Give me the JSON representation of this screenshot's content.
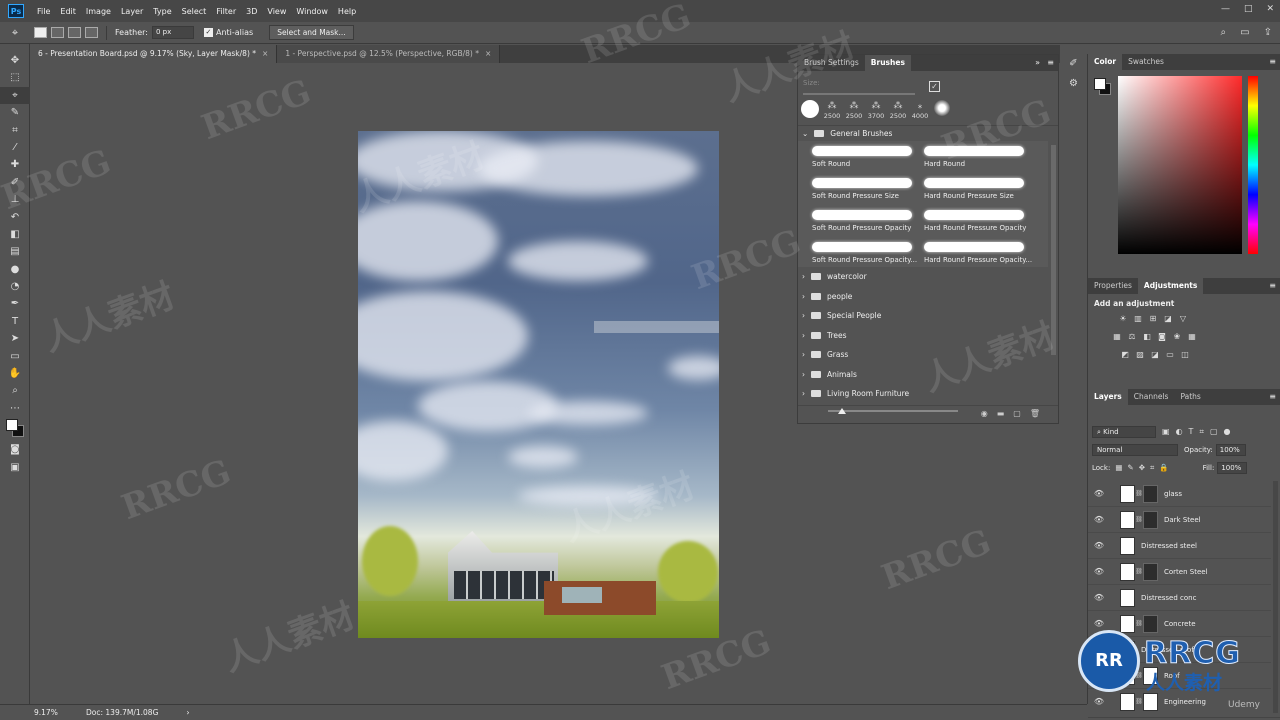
{
  "menubar": {
    "logo": "Ps",
    "items": [
      "File",
      "Edit",
      "Image",
      "Layer",
      "Type",
      "Select",
      "Filter",
      "3D",
      "View",
      "Window",
      "Help"
    ],
    "window_controls": [
      "—",
      "□",
      "✕"
    ]
  },
  "options": {
    "feather_label": "Feather:",
    "feather_value": "0 px",
    "antialias_label": "Anti-alias",
    "select_mask_label": "Select and Mask..."
  },
  "doc_tabs": [
    {
      "label": "6 - Presentation Board.psd @ 9.17% (Sky, Layer Mask/8) *",
      "close": "×"
    },
    {
      "label": "1 - Perspective.psd @ 12.5% (Perspective, RGB/8) *",
      "close": "×"
    }
  ],
  "brushes": {
    "tabs": [
      "Brush Settings",
      "Brushes"
    ],
    "size_label": "Size:",
    "recent_sizes": [
      "2500",
      "2500",
      "3700",
      "2500",
      "4000"
    ],
    "group_title": "General Brushes",
    "presets": [
      "Soft Round",
      "Hard Round",
      "Soft Round Pressure Size",
      "Hard Round Pressure Size",
      "Soft Round Pressure Opacity",
      "Hard Round Pressure Opacity",
      "Soft Round Pressure Opacity...",
      "Hard Round Pressure Opacity..."
    ],
    "folders": [
      "watercolor",
      "people",
      "Special People",
      "Trees",
      "Grass",
      "Animals",
      "Living Room Furniture"
    ]
  },
  "color_panel": {
    "tabs": [
      "Color",
      "Swatches"
    ]
  },
  "adjustments": {
    "tabs": [
      "Properties",
      "Adjustments"
    ],
    "title": "Add an adjustment"
  },
  "layers": {
    "tabs": [
      "Layers",
      "Channels",
      "Paths"
    ],
    "kind_label": "Kind",
    "blend_mode": "Normal",
    "opacity_label": "Opacity:",
    "opacity_value": "100%",
    "lock_label": "Lock:",
    "fill_label": "Fill:",
    "fill_value": "100%",
    "items": [
      {
        "name": "glass",
        "mask": "dark"
      },
      {
        "name": "Dark Steel",
        "mask": "dark"
      },
      {
        "name": "Distressed steel",
        "mask": "none"
      },
      {
        "name": "Corten Steel",
        "mask": "dark"
      },
      {
        "name": "Distressed conc",
        "mask": "none"
      },
      {
        "name": "Concrete",
        "mask": "dark"
      },
      {
        "name": "Distressed roof",
        "mask": "none"
      },
      {
        "name": "Roof",
        "mask": "white"
      },
      {
        "name": "Engineering",
        "mask": "white"
      }
    ]
  },
  "status": {
    "zoom": "9.17%",
    "doc": "Doc: 139.7M/1.08G",
    "arrow": "›"
  },
  "watermark": {
    "brand": "RRCG",
    "cn": "人人素材",
    "udemy": "Udemy"
  }
}
